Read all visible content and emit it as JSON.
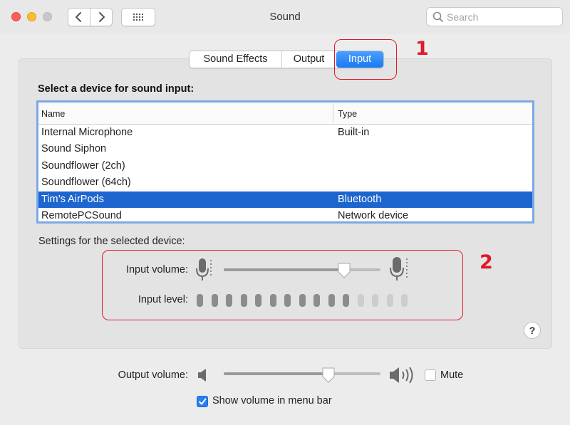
{
  "window": {
    "title": "Sound"
  },
  "search": {
    "placeholder": "Search"
  },
  "icons": {
    "close": "close-icon",
    "minimize": "minimize-icon",
    "zoom": "zoom-icon",
    "back": "chevron-left-icon",
    "forward": "chevron-right-icon",
    "grid": "grid-icon",
    "search": "search-icon",
    "mic_low": "microphone-low-icon",
    "mic_high": "microphone-high-icon",
    "speaker_low": "speaker-low-icon",
    "speaker_high": "speaker-high-icon",
    "help": "help-icon",
    "checkmark": "checkmark-icon"
  },
  "tabs": [
    {
      "label": "Sound Effects",
      "selected": false
    },
    {
      "label": "Output",
      "selected": false
    },
    {
      "label": "Input",
      "selected": true
    }
  ],
  "device_section": {
    "label": "Select a device for sound input:",
    "columns": [
      "Name",
      "Type"
    ],
    "rows": [
      {
        "name": "Internal Microphone",
        "type": "Built-in"
      },
      {
        "name": "Sound Siphon",
        "type": ""
      },
      {
        "name": "Soundflower (2ch)",
        "type": ""
      },
      {
        "name": "Soundflower (64ch)",
        "type": ""
      },
      {
        "name": "Tim’s AirPods",
        "type": "Bluetooth",
        "selected": true
      },
      {
        "name": "RemotePCSound",
        "type": "Network device"
      }
    ]
  },
  "settings": {
    "label": "Settings for the selected device:",
    "input_volume_label": "Input volume:",
    "input_volume": 0.77,
    "input_level_label": "Input level:",
    "input_level_total": 15,
    "input_level_active": 11
  },
  "output": {
    "label": "Output volume:",
    "volume": 0.67,
    "mute_label": "Mute",
    "mute_checked": false,
    "show_in_menu_bar_label": "Show volume in menu bar",
    "show_in_menu_bar_checked": true
  },
  "help": {
    "label": "?"
  },
  "annotations": [
    {
      "label": "1"
    },
    {
      "label": "2"
    }
  ],
  "colors": {
    "accent": "#1a79f0",
    "selection": "#1d66cf",
    "annotation": "#e0192a",
    "level_active": "#8c8c8c",
    "level_inactive": "#cdcdcd"
  }
}
